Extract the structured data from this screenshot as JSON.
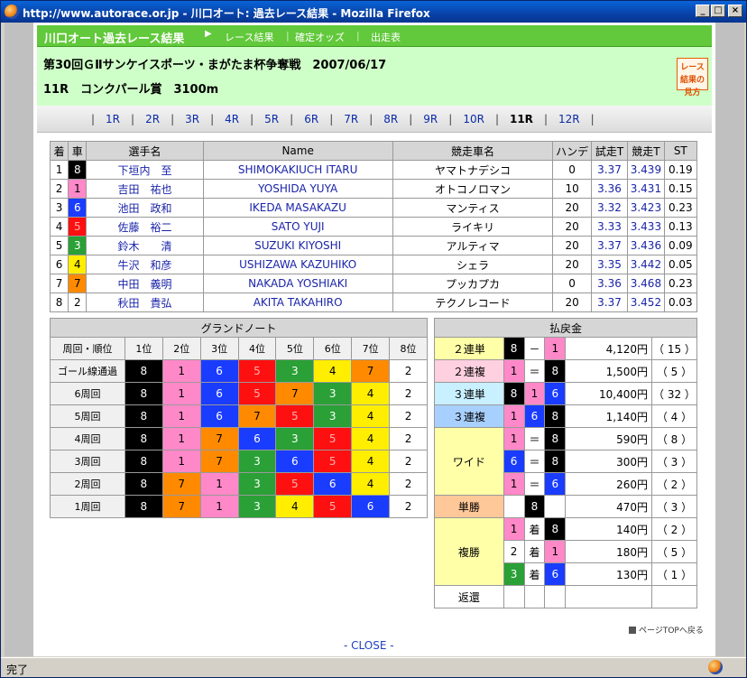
{
  "window": {
    "title": "http://www.autorace.or.jp - 川口オート: 過去レース結果 - Mozilla Firefox"
  },
  "nav": {
    "site_name": "川口オート過去レース結果",
    "links": [
      "レース結果",
      "確定オッズ",
      "出走表"
    ]
  },
  "race": {
    "title": "第30回ＧⅡサンケイスポーツ・まがたま杯争奪戦　2007/06/17",
    "subtitle": "11R　コンクパール賞　3100m",
    "guide_label": "レース結果の見方"
  },
  "race_links": [
    "1R",
    "2R",
    "3R",
    "4R",
    "5R",
    "6R",
    "7R",
    "8R",
    "9R",
    "10R",
    "11R",
    "12R"
  ],
  "current_race": "11R",
  "entries": {
    "headers": [
      "着",
      "車",
      "選手名",
      "Name",
      "競走車名",
      "ハンデ",
      "試走T",
      "競走T",
      "ST"
    ],
    "rows": [
      {
        "place": "1",
        "car": "8",
        "rider": "下垣内　至",
        "name": "SHIMOKAKIUCH ITARU",
        "machine": "ヤマトナデシコ",
        "handicap": "0",
        "trial": "3.37",
        "race_t": "3.439",
        "st": "0.19"
      },
      {
        "place": "2",
        "car": "1",
        "rider": "吉田　祐也",
        "name": "YOSHIDA YUYA",
        "machine": "オトコノロマン",
        "handicap": "10",
        "trial": "3.36",
        "race_t": "3.431",
        "st": "0.15"
      },
      {
        "place": "3",
        "car": "6",
        "rider": "池田　政和",
        "name": "IKEDA MASAKAZU",
        "machine": "マンティス",
        "handicap": "20",
        "trial": "3.32",
        "race_t": "3.423",
        "st": "0.23"
      },
      {
        "place": "4",
        "car": "5",
        "rider": "佐藤　裕二",
        "name": "SATO YUJI",
        "machine": "ライキリ",
        "handicap": "20",
        "trial": "3.33",
        "race_t": "3.433",
        "st": "0.13"
      },
      {
        "place": "5",
        "car": "3",
        "rider": "鈴木　　清",
        "name": "SUZUKI KIYOSHI",
        "machine": "アルティマ",
        "handicap": "20",
        "trial": "3.37",
        "race_t": "3.436",
        "st": "0.09"
      },
      {
        "place": "6",
        "car": "4",
        "rider": "牛沢　和彦",
        "name": "USHIZAWA KAZUHIKO",
        "machine": "シェラ",
        "handicap": "20",
        "trial": "3.35",
        "race_t": "3.442",
        "st": "0.05"
      },
      {
        "place": "7",
        "car": "7",
        "rider": "中田　義明",
        "name": "NAKADA YOSHIAKI",
        "machine": "プッカプカ",
        "handicap": "0",
        "trial": "3.36",
        "race_t": "3.468",
        "st": "0.23"
      },
      {
        "place": "8",
        "car": "2",
        "rider": "秋田　貴弘",
        "name": "AKITA TAKAHIRO",
        "machine": "テクノレコード",
        "handicap": "20",
        "trial": "3.37",
        "race_t": "3.452",
        "st": "0.03"
      }
    ]
  },
  "grand_note": {
    "title": "グランドノート",
    "corner_header": "周回・順位",
    "positions": [
      "1位",
      "2位",
      "3位",
      "4位",
      "5位",
      "6位",
      "7位",
      "8位"
    ],
    "rows": [
      {
        "label": "ゴール線通過",
        "cars": [
          "8",
          "1",
          "6",
          "5",
          "3",
          "4",
          "7",
          "2"
        ]
      },
      {
        "label": "6周回",
        "cars": [
          "8",
          "1",
          "6",
          "5",
          "7",
          "3",
          "4",
          "2"
        ]
      },
      {
        "label": "5周回",
        "cars": [
          "8",
          "1",
          "6",
          "7",
          "5",
          "3",
          "4",
          "2"
        ]
      },
      {
        "label": "4周回",
        "cars": [
          "8",
          "1",
          "7",
          "6",
          "3",
          "5",
          "4",
          "2"
        ]
      },
      {
        "label": "3周回",
        "cars": [
          "8",
          "1",
          "7",
          "3",
          "6",
          "5",
          "4",
          "2"
        ]
      },
      {
        "label": "2周回",
        "cars": [
          "8",
          "7",
          "1",
          "3",
          "5",
          "6",
          "4",
          "2"
        ]
      },
      {
        "label": "1周回",
        "cars": [
          "8",
          "7",
          "1",
          "3",
          "4",
          "5",
          "6",
          "2"
        ]
      }
    ]
  },
  "payout": {
    "title": "払戻金",
    "rows": [
      {
        "type": "２連単",
        "a": "8",
        "sep": "－",
        "b": "1",
        "amount": "4,120円",
        "pop": "（ 15 ）"
      },
      {
        "type": "２連複",
        "a": "1",
        "sep": "＝",
        "b": "8",
        "amount": "1,500円",
        "pop": "（ 5 ）"
      },
      {
        "type": "３連単",
        "a": "8",
        "sep": "1",
        "b": "6",
        "amount": "10,400円",
        "pop": "（ 32 ）"
      },
      {
        "type": "３連複",
        "a": "1",
        "sep": "6",
        "b": "8",
        "amount": "1,140円",
        "pop": "（ 4 ）"
      },
      {
        "type": "ワイド",
        "a": "1",
        "sep": "＝",
        "b": "8",
        "amount": "590円",
        "pop": "（ 8 ）"
      },
      {
        "type": "",
        "a": "6",
        "sep": "＝",
        "b": "8",
        "amount": "300円",
        "pop": "（ 3 ）"
      },
      {
        "type": "",
        "a": "1",
        "sep": "＝",
        "b": "6",
        "amount": "260円",
        "pop": "（ 2 ）"
      },
      {
        "type": "単勝",
        "a": "",
        "sep": "8",
        "b": "",
        "amount": "470円",
        "pop": "（ 3 ）"
      },
      {
        "type": "複勝",
        "a": "1",
        "sep": "着",
        "b": "8",
        "amount": "140円",
        "pop": "（ 2 ）"
      },
      {
        "type": "",
        "a": "2",
        "sep": "着",
        "b": "1",
        "amount": "180円",
        "pop": "（ 5 ）"
      },
      {
        "type": "",
        "a": "3",
        "sep": "着",
        "b": "6",
        "amount": "130円",
        "pop": "（ 1 ）"
      },
      {
        "type": "返還",
        "a": "",
        "sep": "",
        "b": "",
        "amount": "",
        "pop": ""
      }
    ]
  },
  "footer": {
    "pagetop": "ページTOPへ戻る",
    "close": "- CLOSE -"
  },
  "status": {
    "text": "完了"
  },
  "car_colors": {
    "1": "#ffffff",
    "2": "#000000",
    "3": "#ff1010",
    "4": "#1a3cff",
    "5": "#ffee00",
    "6": "#2aa036",
    "7": "#ff8a00",
    "8": "#ff88c8"
  },
  "type_colors": {
    "２連単": "#ffffa8",
    "２連複": "#ffd0e0",
    "３連単": "#c8f0ff",
    "３連複": "#a8d0ff",
    "ワイド": "#ffffa8",
    "単勝": "#ffc898",
    "複勝": "#ffffa8",
    "返還": "#ffffff"
  }
}
